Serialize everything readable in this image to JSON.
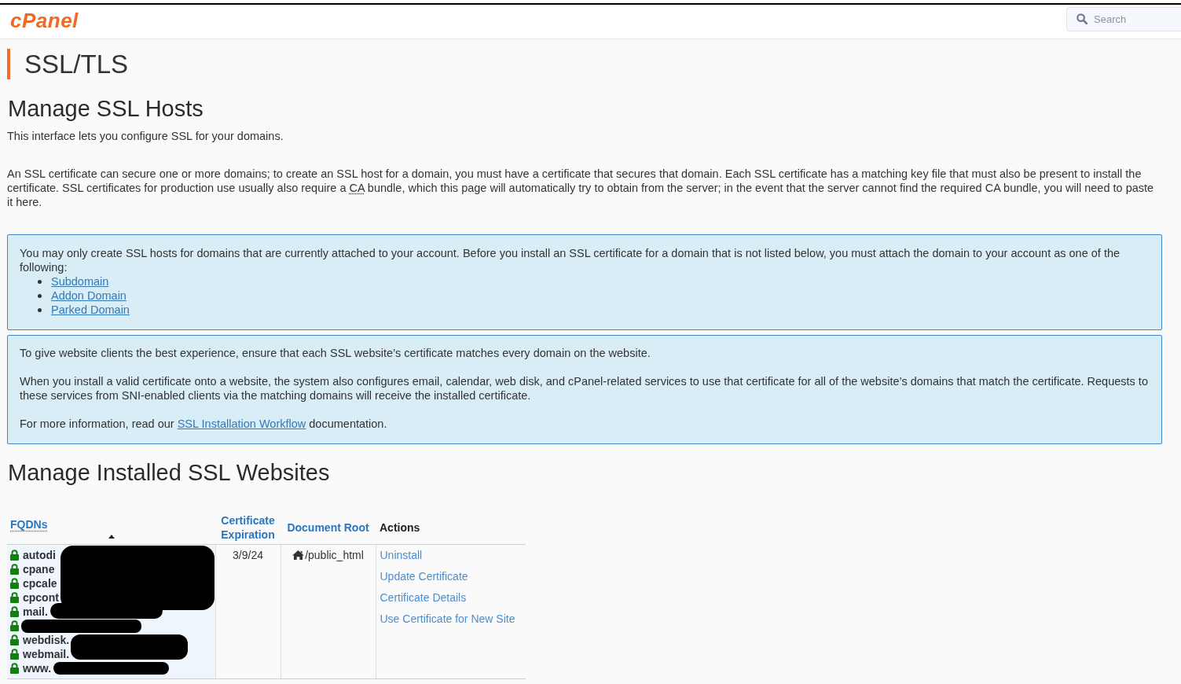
{
  "header": {
    "logo": "cPanel",
    "search": {
      "placeholder": "Search"
    }
  },
  "page_title": "SSL/TLS",
  "hosts_section": {
    "heading": "Manage SSL Hosts",
    "subtitle": "This interface lets you configure SSL for your domains.",
    "description": [
      {
        "kind": "text",
        "text": "An SSL certificate can secure one or more domains; to create an SSL host for a domain, you must have a certificate that secures that domain. Each SSL certificate has a matching key file that must also be present to install the certificate. SSL certificates for production use usually also require a "
      },
      {
        "kind": "abbreviation",
        "text": "CA"
      },
      {
        "kind": "text",
        "text": " bundle, which this page will automatically try to obtain from the server; in the event that the server cannot find the required CA bundle, you will need to paste it here."
      }
    ],
    "notices": [
      {
        "paragraphs": [
          [
            {
              "kind": "text",
              "text": "You may only create SSL hosts for domains that are currently attached to your account. Before you install an SSL certificate for a domain that is not listed below, you must attach the domain to your account as one of the following:"
            }
          ]
        ],
        "links": [
          "Subdomain",
          "Addon Domain",
          "Parked Domain"
        ]
      },
      {
        "paragraphs": [
          [
            {
              "kind": "text",
              "text": "To give website clients the best experience, ensure that each SSL website’s certificate matches every domain on the website."
            }
          ],
          [
            {
              "kind": "text",
              "text": "When you install a valid certificate onto a website, the system also configures email, calendar, web disk, and cPanel-related services to use that certificate for all of the website’s domains that match the certificate. Requests to these services from SNI-enabled clients via the matching domains will receive the installed certificate."
            }
          ],
          [
            {
              "kind": "text",
              "text": "For more information, read our "
            },
            {
              "kind": "link",
              "text": "SSL Installation Workflow"
            },
            {
              "kind": "text",
              "text": " documentation."
            }
          ]
        ]
      }
    ]
  },
  "websites_section": {
    "heading": "Manage Installed SSL Websites",
    "table": {
      "columns": [
        {
          "label": "FQDNs",
          "sortable": true,
          "abbreviation": true,
          "sorted": true
        },
        {
          "label": "Certificate Expiration",
          "sortable": true,
          "abbreviation": false,
          "sorted": false
        },
        {
          "label": "Document Root",
          "sortable": true,
          "abbreviation": false,
          "sorted": false
        },
        {
          "label": "Actions",
          "sortable": false,
          "abbreviation": false,
          "sorted": false
        }
      ],
      "rows": [
        {
          "fqdns": [
            {
              "name": "autodi",
              "locked": true
            },
            {
              "name": "cpane",
              "locked": true
            },
            {
              "name": "cpcale",
              "locked": true
            },
            {
              "name": "cpcont",
              "locked": true
            },
            {
              "name": "mail.",
              "locked": true
            },
            {
              "locked": true
            },
            {
              "name": "webdisk.",
              "locked": true
            },
            {
              "name": "webmail.",
              "locked": true
            },
            {
              "name": "www.",
              "locked": true
            }
          ],
          "expiration": "3/9/24",
          "document_root": "/public_html",
          "actions": [
            "Uninstall",
            "Update Certificate",
            "Certificate Details",
            "Use Certificate for New Site"
          ]
        }
      ]
    }
  }
}
